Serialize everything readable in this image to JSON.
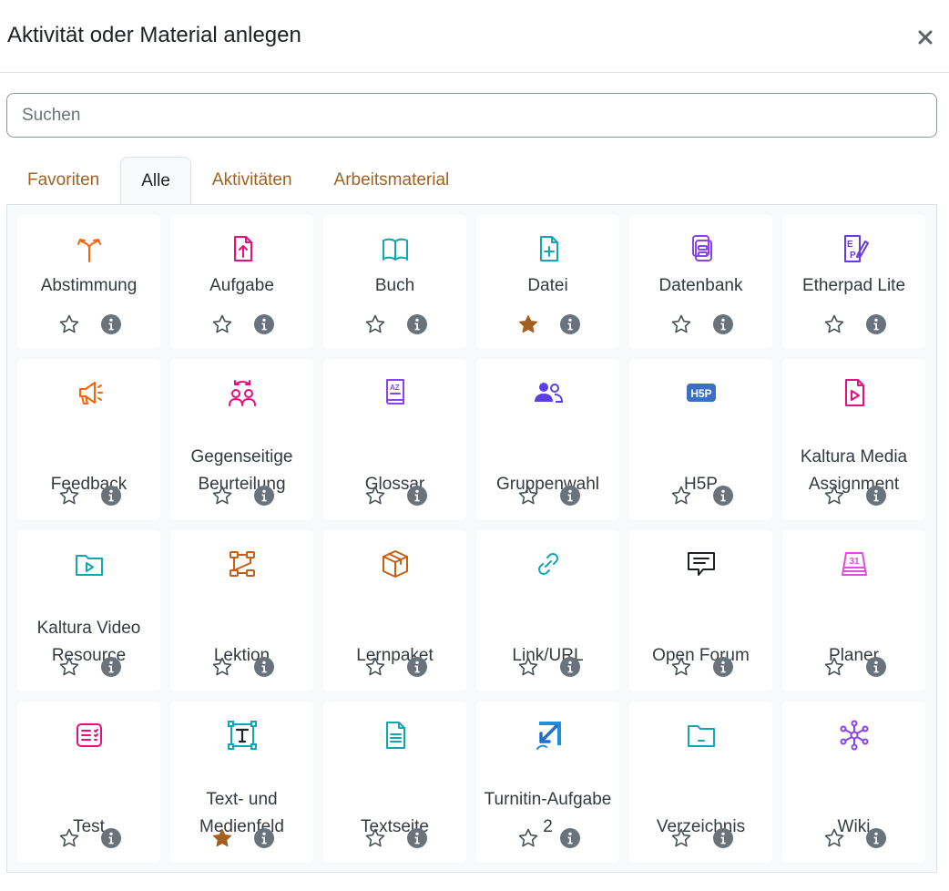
{
  "modal": {
    "title": "Aktivität oder Material anlegen"
  },
  "search": {
    "placeholder": "Suchen"
  },
  "tabs": [
    {
      "label": "Favoriten",
      "active": false
    },
    {
      "label": "Alle",
      "active": true
    },
    {
      "label": "Aktivitäten",
      "active": false
    },
    {
      "label": "Arbeitsmaterial",
      "active": false
    }
  ],
  "colors": {
    "orange": "#f7630c",
    "pink": "#eb0c80",
    "teal": "#11a6b5",
    "purple": "#8a43f2",
    "blue": "#3b5bd6",
    "brown": "#cc5d0e",
    "link": "#a26121",
    "star_filled": "#a26121"
  },
  "items": [
    {
      "label": "Abstimmung",
      "icon": "split-arrow-icon",
      "color": "#f7630c",
      "favorite": false
    },
    {
      "label": "Aufgabe",
      "icon": "file-upload-icon",
      "color": "#eb0c80",
      "favorite": false
    },
    {
      "label": "Buch",
      "icon": "book-icon",
      "color": "#11a6b5",
      "favorite": false
    },
    {
      "label": "Datei",
      "icon": "file-plus-icon",
      "color": "#11a6b5",
      "favorite": true
    },
    {
      "label": "Datenbank",
      "icon": "database-icon",
      "color": "#8a43f2",
      "favorite": false
    },
    {
      "label": "Etherpad Lite",
      "icon": "etherpad-icon",
      "color": "#6a3cd6",
      "favorite": false
    },
    {
      "label": "Feedback",
      "icon": "megaphone-icon",
      "color": "#f7630c",
      "favorite": false
    },
    {
      "label": "Gegenseitige Beurteilung",
      "icon": "peer-review-icon",
      "color": "#eb0c80",
      "favorite": false
    },
    {
      "label": "Glossar",
      "icon": "glossary-icon",
      "color": "#8a43f2",
      "favorite": false
    },
    {
      "label": "Gruppenwahl",
      "icon": "users-icon",
      "color": "#5c3fe0",
      "favorite": false
    },
    {
      "label": "H5P",
      "icon": "h5p-icon",
      "color": "#3b6fc4",
      "favorite": false
    },
    {
      "label": "Kaltura Media Assignment",
      "icon": "file-play-icon",
      "color": "#eb0c80",
      "favorite": false
    },
    {
      "label": "Kaltura Video Resource",
      "icon": "folder-play-icon",
      "color": "#11a6b5",
      "favorite": false
    },
    {
      "label": "Lektion",
      "icon": "lesson-flow-icon",
      "color": "#cc5d0e",
      "favorite": false
    },
    {
      "label": "Lernpaket",
      "icon": "package-icon",
      "color": "#cc5d0e",
      "favorite": false
    },
    {
      "label": "Link/URL",
      "icon": "link-icon",
      "color": "#11a6b5",
      "favorite": false
    },
    {
      "label": "Open Forum",
      "icon": "chat-icon",
      "color": "#1d2125",
      "favorite": false
    },
    {
      "label": "Planer",
      "icon": "calendar-icon",
      "color": "#e04ce0",
      "favorite": false
    },
    {
      "label": "Test",
      "icon": "quiz-icon",
      "color": "#eb0c80",
      "favorite": false
    },
    {
      "label": "Text- und Medienfeld",
      "icon": "text-frame-icon",
      "color": "#11a6b5",
      "favorite": true
    },
    {
      "label": "Textseite",
      "icon": "text-page-icon",
      "color": "#11a6b5",
      "favorite": false
    },
    {
      "label": "Turnitin-Aufgabe 2",
      "icon": "turnitin-icon",
      "color": "#1b8fe0",
      "favorite": false
    },
    {
      "label": "Verzeichnis",
      "icon": "folder-icon",
      "color": "#11a6b5",
      "favorite": false
    },
    {
      "label": "Wiki",
      "icon": "wiki-network-icon",
      "color": "#8a43f2",
      "favorite": false
    }
  ]
}
